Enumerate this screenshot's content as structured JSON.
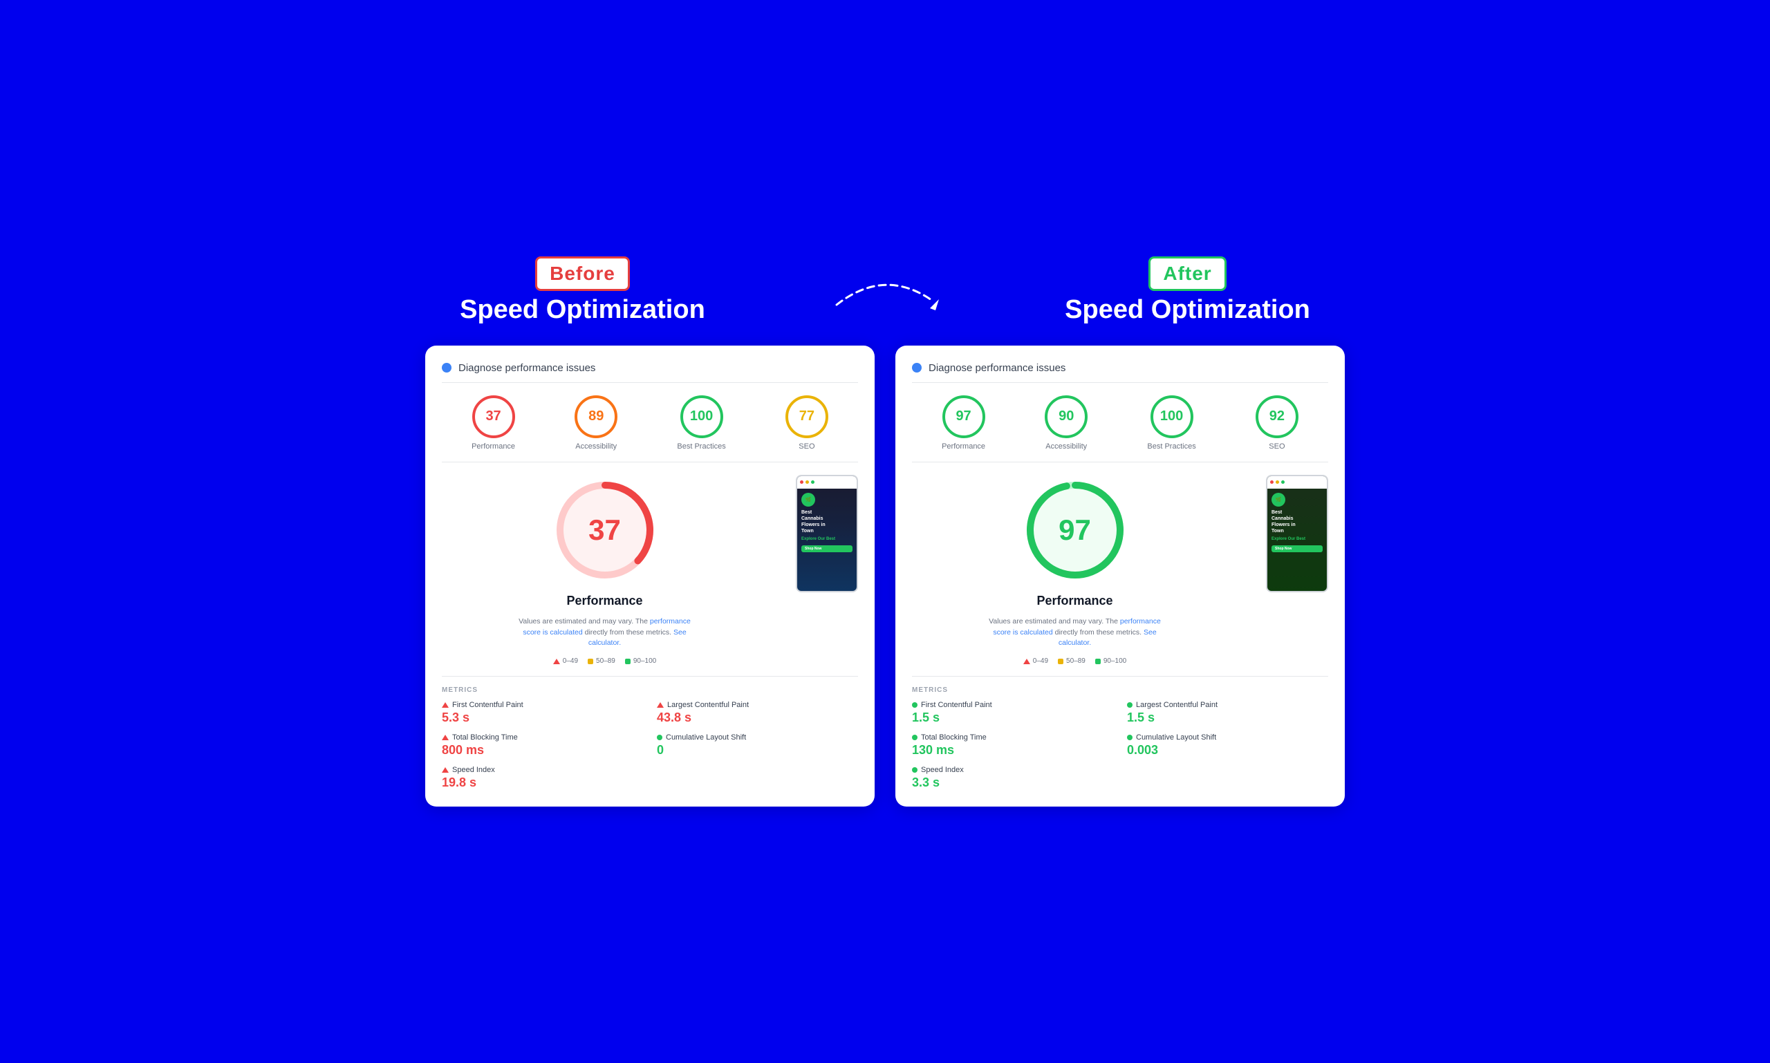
{
  "page": {
    "background_color": "#0000ee"
  },
  "before": {
    "badge": "Before",
    "title": "Speed Optimization",
    "card_title": "Diagnose performance issues",
    "scores": [
      {
        "value": "37",
        "label": "Performance",
        "type": "red"
      },
      {
        "value": "89",
        "label": "Accessibility",
        "type": "orange"
      },
      {
        "value": "100",
        "label": "Best Practices",
        "type": "green"
      },
      {
        "value": "77",
        "label": "SEO",
        "type": "yellow"
      }
    ],
    "big_score": "37",
    "big_score_type": "red",
    "perf_title": "Performance",
    "perf_desc_1": "Values are estimated and may vary. The ",
    "perf_desc_link": "performance score is calculated",
    "perf_desc_2": " directly from these metrics. ",
    "perf_desc_link2": "See calculator.",
    "legend": [
      {
        "type": "triangle",
        "label": "0–49"
      },
      {
        "type": "square-yellow",
        "label": "50–89"
      },
      {
        "type": "square-green",
        "label": "90–100"
      }
    ],
    "metrics_label": "METRICS",
    "metrics": [
      {
        "label": "First Contentful Paint",
        "value": "5.3 s",
        "type": "red"
      },
      {
        "label": "Largest Contentful Paint",
        "value": "43.8 s",
        "type": "red"
      },
      {
        "label": "Total Blocking Time",
        "value": "800 ms",
        "type": "red"
      },
      {
        "label": "Cumulative Layout Shift",
        "value": "0",
        "type": "green"
      },
      {
        "label": "Speed Index",
        "value": "19.8 s",
        "type": "red"
      }
    ],
    "screenshot_texts": [
      "Best",
      "Cannabis",
      "Flowers in",
      "Town"
    ],
    "screenshot_sub": "Explore Our Best"
  },
  "after": {
    "badge": "After",
    "title": "Speed Optimization",
    "card_title": "Diagnose performance issues",
    "scores": [
      {
        "value": "97",
        "label": "Performance",
        "type": "green"
      },
      {
        "value": "90",
        "label": "Accessibility",
        "type": "green"
      },
      {
        "value": "100",
        "label": "Best Practices",
        "type": "green"
      },
      {
        "value": "92",
        "label": "SEO",
        "type": "green"
      }
    ],
    "big_score": "97",
    "big_score_type": "green",
    "perf_title": "Performance",
    "perf_desc_1": "Values are estimated and may vary. The ",
    "perf_desc_link": "performance score is calculated",
    "perf_desc_2": " directly from these metrics. ",
    "perf_desc_link2": "See calculator.",
    "metrics_label": "METRICS",
    "metrics": [
      {
        "label": "First Contentful Paint",
        "value": "1.5 s",
        "type": "green"
      },
      {
        "label": "Largest Contentful Paint",
        "value": "1.5 s",
        "type": "green"
      },
      {
        "label": "Total Blocking Time",
        "value": "130 ms",
        "type": "green"
      },
      {
        "label": "Cumulative Layout Shift",
        "value": "0.003",
        "type": "green"
      },
      {
        "label": "Speed Index",
        "value": "3.3 s",
        "type": "green"
      }
    ],
    "screenshot_texts": [
      "Best",
      "Cannabis",
      "Flowers in",
      "Town"
    ],
    "screenshot_sub": "Explore Our Best"
  }
}
